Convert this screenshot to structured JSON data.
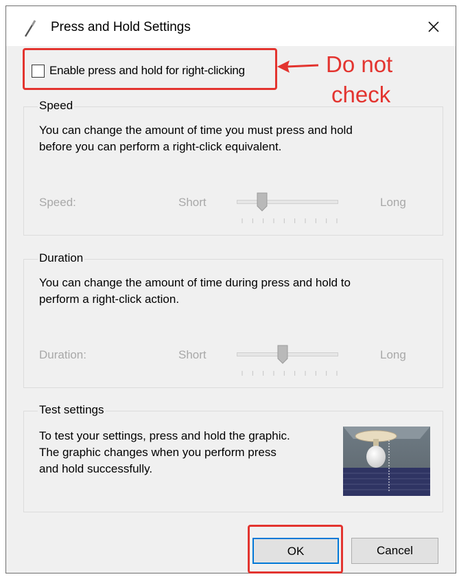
{
  "window": {
    "title": "Press and Hold Settings",
    "title_icon": "pen-icon",
    "close_icon": "close-icon"
  },
  "enable_checkbox": {
    "label": "Enable press and hold for right-clicking",
    "checked": false
  },
  "annotation": {
    "line1": "Do not",
    "line2": "check",
    "color": "#e3342f"
  },
  "speed": {
    "group_title": "Speed",
    "description_line1": "You can change the amount of time you must press and hold",
    "description_line2": "before you can perform a right-click equivalent.",
    "label": "Speed:",
    "min_label": "Short",
    "max_label": "Long",
    "value_fraction": 0.25,
    "tick_count": 10
  },
  "duration": {
    "group_title": "Duration",
    "description_line1": "You can change the amount of time during press and hold to",
    "description_line2": "perform a right-click action.",
    "label": "Duration:",
    "min_label": "Short",
    "max_label": "Long",
    "value_fraction": 0.45,
    "tick_count": 10
  },
  "test": {
    "group_title": "Test settings",
    "description_line1": "To test your settings, press and hold the graphic.",
    "description_line2": "The graphic changes when you perform press",
    "description_line3": "and hold successfully."
  },
  "buttons": {
    "ok": "OK",
    "cancel": "Cancel"
  },
  "colors": {
    "highlight": "#e3342f",
    "focus": "#0078d7"
  }
}
